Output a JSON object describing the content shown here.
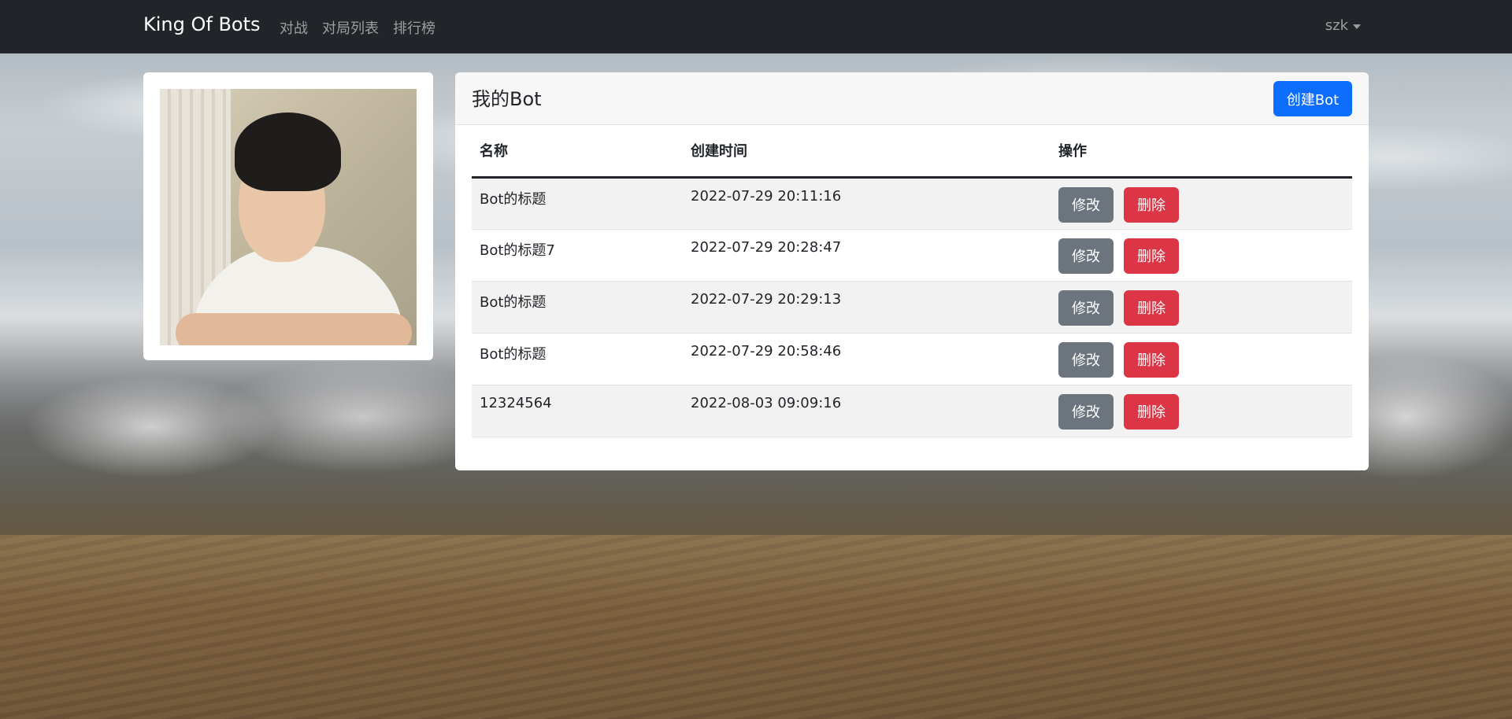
{
  "navbar": {
    "brand": "King Of Bots",
    "links": [
      "对战",
      "对局列表",
      "排行榜"
    ],
    "user": "szk"
  },
  "botList": {
    "title": "我的Bot",
    "createLabel": "创建Bot",
    "columns": [
      "名称",
      "创建时间",
      "操作"
    ],
    "editLabel": "修改",
    "deleteLabel": "删除",
    "rows": [
      {
        "name": "Bot的标题",
        "created": "2022-07-29 20:11:16"
      },
      {
        "name": "Bot的标题7",
        "created": "2022-07-29 20:28:47"
      },
      {
        "name": "Bot的标题",
        "created": "2022-07-29 20:29:13"
      },
      {
        "name": "Bot的标题",
        "created": "2022-07-29 20:58:46"
      },
      {
        "name": "12324564",
        "created": "2022-08-03 09:09:16"
      }
    ]
  },
  "colors": {
    "navbar": "#212529",
    "primary": "#0d6efd",
    "secondary": "#6c757d",
    "danger": "#dc3545"
  }
}
